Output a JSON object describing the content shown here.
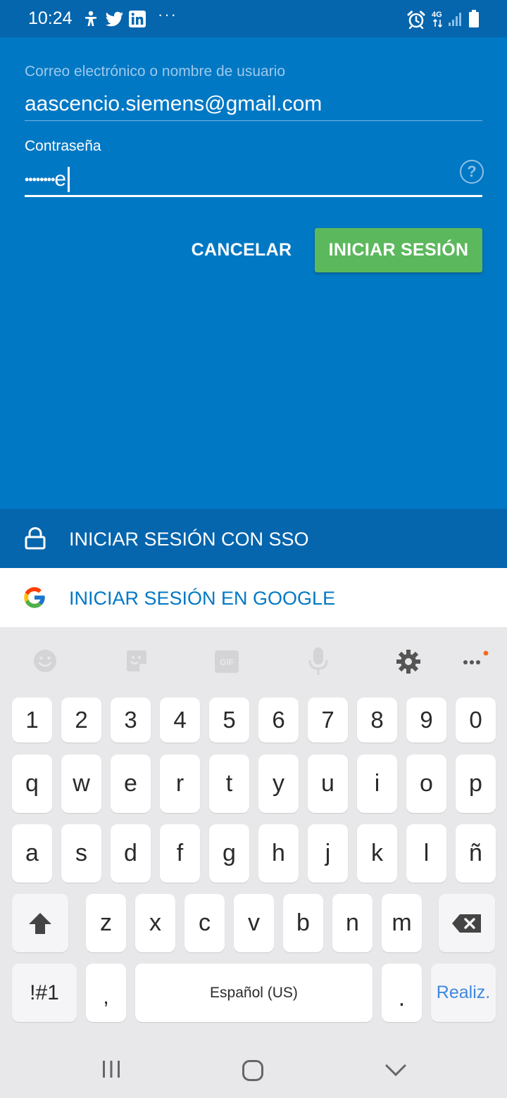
{
  "status_bar": {
    "time": "10:24",
    "more": "···",
    "left_icons": [
      "accessibility-icon",
      "twitter-icon",
      "linkedin-icon",
      "more-notifications-icon"
    ],
    "right_icons": [
      "alarm-icon",
      "4g-icon",
      "signal-icon",
      "battery-icon"
    ],
    "network_label": "4G"
  },
  "login": {
    "email_label": "Correo electrónico o nombre de usuario",
    "email_value": "aascencio.siemens@gmail.com",
    "password_label": "Contraseña",
    "password_masked": "••••••••",
    "password_last_char": "e",
    "help_symbol": "?",
    "cancel_label": "CANCELAR",
    "signin_label": "INICIAR SESIÓN"
  },
  "sso": {
    "label": "INICIAR SESIÓN CON SSO"
  },
  "google": {
    "label": "INICIAR SESIÓN EN GOOGLE"
  },
  "keyboard": {
    "toolbar": [
      "emoji-icon",
      "sticker-icon",
      "gif-icon",
      "microphone-icon",
      "settings-icon",
      "more-options-icon"
    ],
    "gif_label": "GIF",
    "row_numbers": [
      "1",
      "2",
      "3",
      "4",
      "5",
      "6",
      "7",
      "8",
      "9",
      "0"
    ],
    "row_1": [
      "q",
      "w",
      "e",
      "r",
      "t",
      "y",
      "u",
      "i",
      "o",
      "p"
    ],
    "row_2": [
      "a",
      "s",
      "d",
      "f",
      "g",
      "h",
      "j",
      "k",
      "l",
      "ñ"
    ],
    "row_3": [
      "z",
      "x",
      "c",
      "v",
      "b",
      "n",
      "m"
    ],
    "symbols_label": "!#1",
    "comma_label": ",",
    "space_label": "Español (US)",
    "period_label": ".",
    "done_label": "Realiz."
  },
  "colors": {
    "brand_blue": "#0078c4",
    "dark_blue": "#0565ad",
    "signin_green": "#5cb85c"
  },
  "nav_bar": [
    "recents-icon",
    "home-icon",
    "back-icon"
  ]
}
